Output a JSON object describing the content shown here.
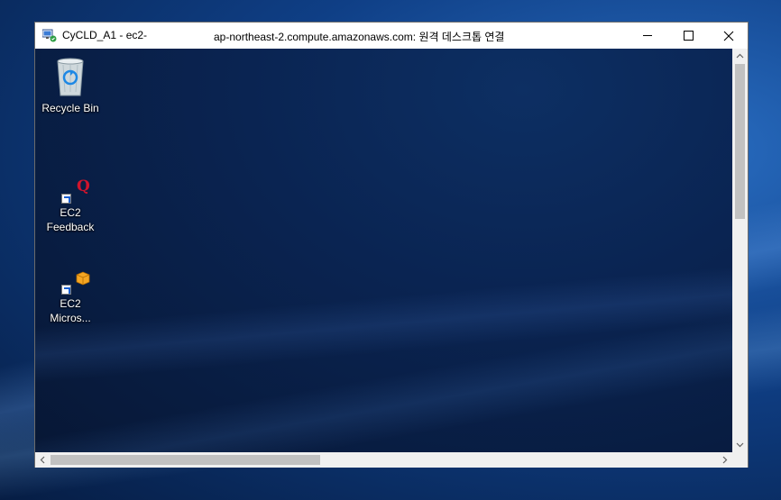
{
  "window": {
    "title_left": "CyCLD_A1 - ec2-",
    "title_right": "ap-northeast-2.compute.amazonaws.com: 원격 데스크톱 연결"
  },
  "desktop_icons": [
    {
      "label": "Recycle Bin",
      "icon": "recycle-bin-icon"
    },
    {
      "label": "EC2\nFeedback",
      "icon": "ec2-feedback-icon"
    },
    {
      "label": "EC2\nMicros...",
      "icon": "ec2-microsoft-icon"
    }
  ],
  "colors": {
    "remote_background": "#0a2452",
    "titlebar": "#ffffff",
    "scrollbar_track": "#f0f0f0",
    "scrollbar_thumb": "#c1c1c1"
  }
}
